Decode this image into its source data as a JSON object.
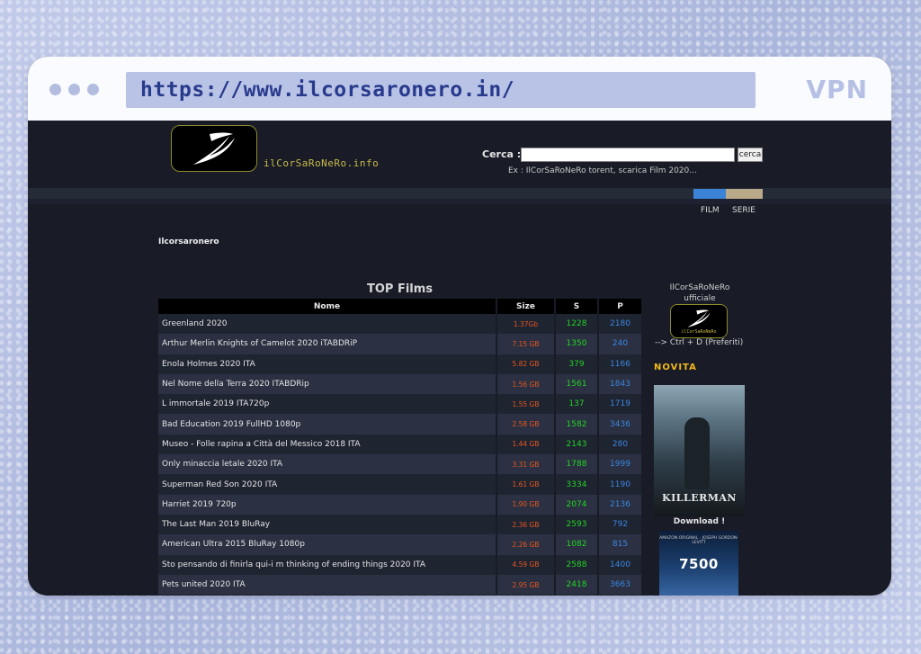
{
  "browser": {
    "url": "https://www.ilcorsaronero.in/",
    "badge": "VPN"
  },
  "site": {
    "logo_text": "ilCorSaRoNeRo.info",
    "search": {
      "label": "Cerca :",
      "value": "",
      "button": "cerca",
      "hint": "Ex : IlCorSaRoNeRo torent, scarica Film 2020..."
    },
    "nav": {
      "film": "FILM",
      "serie": "SERIE"
    },
    "breadcrumb": "Ilcorsaronero",
    "colors": {
      "seed": "#22d322",
      "peer": "#3a86e0",
      "size": "#e7561e",
      "accent": "#f2b81a"
    }
  },
  "top_films": {
    "title": "TOP Films",
    "columns": [
      "Nome",
      "Size",
      "S",
      "P"
    ],
    "rows": [
      {
        "name": "Greenland 2020",
        "size": "1.37Gb",
        "s": "1228",
        "p": "2180"
      },
      {
        "name": "Arthur Merlin Knights of Camelot 2020 iTABDRiP",
        "size": "7.15 GB",
        "s": "1350",
        "p": "240"
      },
      {
        "name": "Enola Holmes 2020 ITA",
        "size": "5.82 GB",
        "s": "379",
        "p": "1166"
      },
      {
        "name": "Nel Nome della Terra 2020 ITABDRip",
        "size": "1.56 GB",
        "s": "1561",
        "p": "1843"
      },
      {
        "name": "L immortale 2019 ITA720p",
        "size": "1.55 GB",
        "s": "137",
        "p": "1719"
      },
      {
        "name": "Bad Education 2019 FullHD 1080p",
        "size": "2.58 GB",
        "s": "1582",
        "p": "3436"
      },
      {
        "name": "Museo - Folle rapina a Città del Messico 2018 ITA",
        "size": "1.44 GB",
        "s": "2143",
        "p": "280"
      },
      {
        "name": "Only minaccia letale 2020 ITA",
        "size": "3.31 GB",
        "s": "1788",
        "p": "1999"
      },
      {
        "name": "Superman Red Son 2020 ITA",
        "size": "1.61 GB",
        "s": "3334",
        "p": "1190"
      },
      {
        "name": "Harriet 2019 720p",
        "size": "1.90 GB",
        "s": "2074",
        "p": "2136"
      },
      {
        "name": "The Last Man 2019 BluRay",
        "size": "2.36 GB",
        "s": "2593",
        "p": "792"
      },
      {
        "name": "American Ultra 2015 BluRay 1080p",
        "size": "2.26 GB",
        "s": "1082",
        "p": "815"
      },
      {
        "name": "Sto pensando di finirla qui-i m thinking of ending things 2020 ITA",
        "size": "4.59 GB",
        "s": "2588",
        "p": "1400"
      },
      {
        "name": "Pets united 2020 ITA",
        "size": "2.95 GB",
        "s": "2418",
        "p": "3663"
      }
    ]
  },
  "sidebar": {
    "title_line1": "IlCorSaRoNeRo",
    "title_line2": "ufficiale",
    "logo_text": "ilCorSaRoNeRo",
    "pref_hint": "--> Ctrl + D (Preferiti)",
    "novita": "NOVITA",
    "poster1_title": "KILLERMAN",
    "download": "Download !",
    "poster2_sup": "AMAZON ORIGINAL · JOSEPH GORDON-LEVITT",
    "poster2_title": "7500"
  }
}
